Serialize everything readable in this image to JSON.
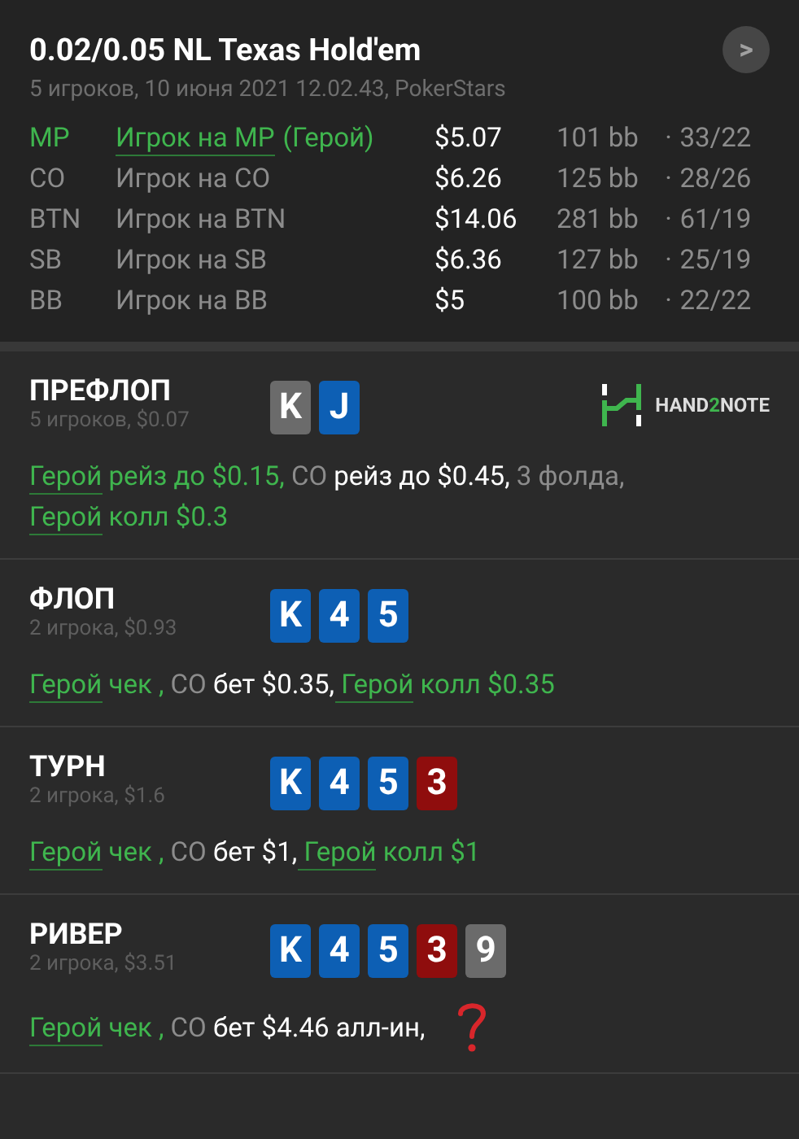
{
  "header": {
    "title": "0.02/0.05 NL Texas Hold'em",
    "subtitle": "5 игроков, 10 июня 2021 12.02.43, PokerStars",
    "next_button": ">"
  },
  "players": [
    {
      "position": "MP",
      "name": "Игрок на MP",
      "hero_tag": "(Герой)",
      "hero": true,
      "stack": "$5.07",
      "bb": "101 bb",
      "separator": "·",
      "stats": "33/22"
    },
    {
      "position": "CO",
      "name": "Игрок на CO",
      "hero": false,
      "stack": "$6.26",
      "bb": "125 bb",
      "separator": "·",
      "stats": "28/26"
    },
    {
      "position": "BTN",
      "name": "Игрок на BTN",
      "hero": false,
      "stack": "$14.06",
      "bb": "281 bb",
      "separator": "·",
      "stats": "61/19"
    },
    {
      "position": "SB",
      "name": "Игрок на SB",
      "hero": false,
      "stack": "$6.36",
      "bb": "127 bb",
      "separator": "·",
      "stats": "25/19"
    },
    {
      "position": "BB",
      "name": "Игрок на BB",
      "hero": false,
      "stack": "$5",
      "bb": "100 bb",
      "separator": "·",
      "stats": "22/22"
    }
  ],
  "streets": [
    {
      "title": "ПРЕФЛОП",
      "subtitle": "5 игроков, $0.07",
      "cards": [
        {
          "rank": "K",
          "color": "#6b6b6b"
        },
        {
          "rank": "J",
          "color": "#0d5fb4"
        }
      ],
      "logo": {
        "start": "HAND",
        "accent": "2",
        "end": "NOTE"
      },
      "actions": [
        {
          "kind": "hero",
          "text": "Герой"
        },
        {
          "kind": "hero-action",
          "text": " рейз до $0.15,"
        },
        {
          "kind": "player",
          "text": " CO"
        },
        {
          "kind": "action",
          "text": " рейз до $0.45,"
        },
        {
          "kind": "player",
          "text": " 3 фолда,"
        },
        {
          "kind": "break"
        },
        {
          "kind": "hero",
          "text": "Герой"
        },
        {
          "kind": "hero-action",
          "text": " колл $0.3"
        }
      ]
    },
    {
      "title": "ФЛОП",
      "subtitle": "2 игрока, $0.93",
      "cards": [
        {
          "rank": "K",
          "color": "#0d5fb4"
        },
        {
          "rank": "4",
          "color": "#0d5fb4"
        },
        {
          "rank": "5",
          "color": "#0d5fb4"
        }
      ],
      "actions": [
        {
          "kind": "hero",
          "text": "Герой"
        },
        {
          "kind": "hero-action",
          "text": " чек ,"
        },
        {
          "kind": "player",
          "text": " CO"
        },
        {
          "kind": "action",
          "text": " бет $0.35,"
        },
        {
          "kind": "hero",
          "text": " Герой"
        },
        {
          "kind": "hero-action",
          "text": " колл $0.35"
        }
      ]
    },
    {
      "title": "ТУРН",
      "subtitle": "2 игрока, $1.6",
      "cards": [
        {
          "rank": "K",
          "color": "#0d5fb4"
        },
        {
          "rank": "4",
          "color": "#0d5fb4"
        },
        {
          "rank": "5",
          "color": "#0d5fb4"
        },
        {
          "rank": "3",
          "color": "#8f0d0d"
        }
      ],
      "actions": [
        {
          "kind": "hero",
          "text": "Герой"
        },
        {
          "kind": "hero-action",
          "text": " чек ,"
        },
        {
          "kind": "player",
          "text": " CO"
        },
        {
          "kind": "action",
          "text": " бет $1,"
        },
        {
          "kind": "hero",
          "text": " Герой"
        },
        {
          "kind": "hero-action",
          "text": " колл $1"
        }
      ]
    },
    {
      "title": "РИВЕР",
      "subtitle": "2 игрока, $3.51",
      "cards": [
        {
          "rank": "K",
          "color": "#0d5fb4"
        },
        {
          "rank": "4",
          "color": "#0d5fb4"
        },
        {
          "rank": "5",
          "color": "#0d5fb4"
        },
        {
          "rank": "3",
          "color": "#8f0d0d"
        },
        {
          "rank": "9",
          "color": "#6b6b6b"
        }
      ],
      "actions": [
        {
          "kind": "hero",
          "text": "Герой"
        },
        {
          "kind": "hero-action",
          "text": " чек ,"
        },
        {
          "kind": "player",
          "text": " CO"
        },
        {
          "kind": "action",
          "text": " бет $4.46 алл-ин,"
        },
        {
          "kind": "question-mark"
        }
      ]
    }
  ]
}
